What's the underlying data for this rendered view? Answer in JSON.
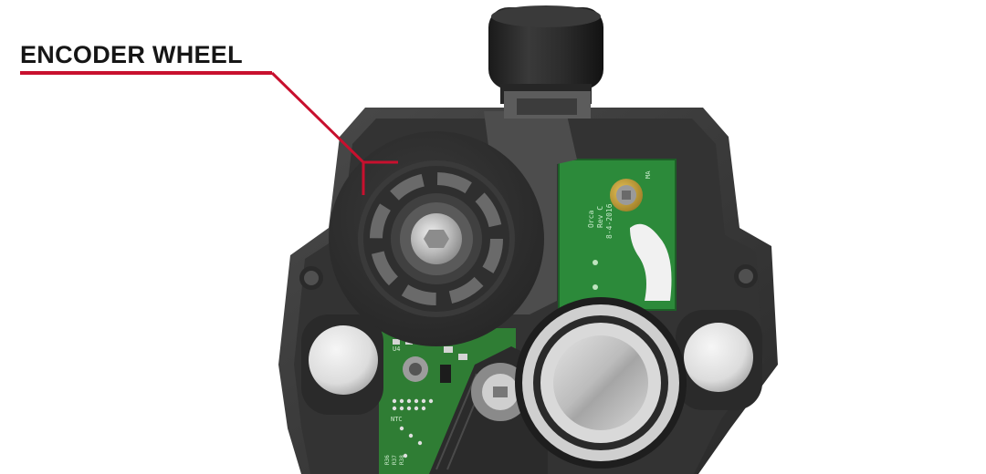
{
  "callout": {
    "label": "ENCODER WHEEL",
    "color": "#c8102e"
  },
  "pcb_right": {
    "line1": "Orca",
    "line2": "Rev C",
    "line3": "8-4-2016",
    "ref": "MA",
    "color": "#2c8a3a"
  },
  "pcb_left": {
    "labels": [
      "U4",
      "NTC",
      "R36",
      "R37",
      "R38"
    ],
    "color": "#2f7d34"
  },
  "housing": {
    "color": "#3c3c3c"
  }
}
